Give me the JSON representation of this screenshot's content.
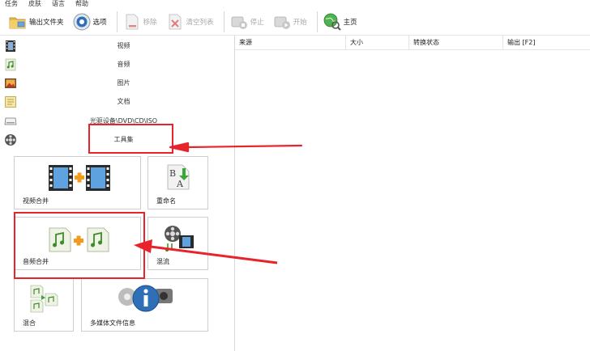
{
  "menu": [
    "任务",
    "皮肤",
    "语言",
    "帮助"
  ],
  "toolbar": {
    "output_folder": "输出文件夹",
    "options": "选项",
    "remove": "移除",
    "clear_list": "清空列表",
    "stop": "停止",
    "start": "开始",
    "home": "主页"
  },
  "categories": [
    "视频",
    "音频",
    "图片",
    "文档",
    "光驱设备\\DVD\\CD\\ISO",
    "工具集"
  ],
  "tools": {
    "video_merge": "视频合并",
    "rename": "重命名",
    "audio_merge": "音频合并",
    "mux": "混流",
    "mix": "混合",
    "media_info": "多媒体文件信息"
  },
  "table": {
    "headers": [
      "来源",
      "大小",
      "转换状态",
      "输出 [F2]"
    ]
  },
  "colors": {
    "annotation": "#e8232b",
    "accent": "#2b7fd6"
  }
}
